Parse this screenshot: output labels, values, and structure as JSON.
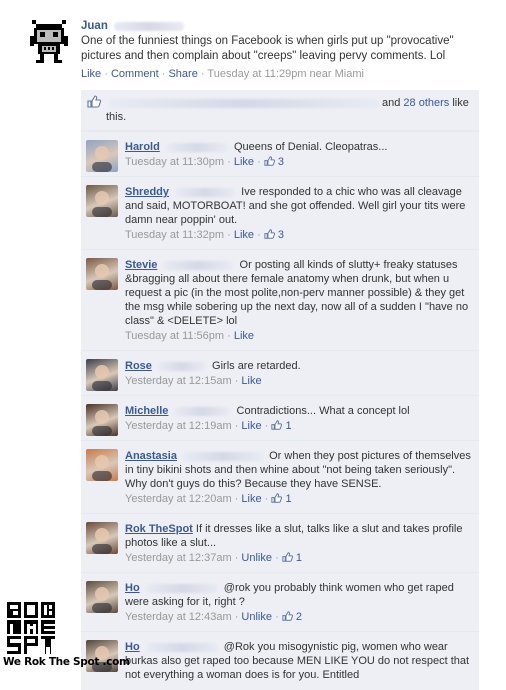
{
  "post": {
    "author": "Juan",
    "text": "One of the funniest things on Facebook is when girls put up \"provocative\" pictures and then complain about \"creeps\" leaving pervy comments. Lol",
    "actions": {
      "like": "Like",
      "comment": "Comment",
      "share": "Share"
    },
    "separator": "·",
    "timestamp": "Tuesday at 11:29pm near Miami"
  },
  "likes": {
    "and": "and",
    "others": "28 others",
    "suffix_before": "like",
    "suffix_after": "this."
  },
  "comments": [
    {
      "name": "Harold",
      "text": "Queens of Denial. Cleopatras...",
      "time": "Tuesday at 11:30pm",
      "action": "Like",
      "likes": "3"
    },
    {
      "name": "Shreddy",
      "text": "Ive responded to a chic who was all cleavage and said, MOTORBOAT! and she got offended. Well girl your tits were damn near poppin' out.",
      "time": "Tuesday at 11:32pm",
      "action": "Like",
      "likes": "3"
    },
    {
      "name": "Stevie",
      "text": "Or posting all kinds of slutty+ freaky statuses &bragging all about there female anatomy when drunk, but when u request a pic (in the most polite,non-perv manner possible) & they get the msg while sobering up the next day, now all of a sudden I \"have no class\" & <DELETE> lol",
      "time": "Tuesday at 11:56pm",
      "action": "Like",
      "likes": ""
    },
    {
      "name": "Rose",
      "text": "Girls are retarded.",
      "time": "Yesterday at 12:15am",
      "action": "Like",
      "likes": ""
    },
    {
      "name": "Michelle",
      "text": "Contradictions... What a concept lol",
      "time": "Yesterday at 12:19am",
      "action": "Like",
      "likes": "1"
    },
    {
      "name": "Anastasia",
      "text": "Or when they post pictures of themselves in tiny bikini shots and then whine about \"not being taken seriously\". Why don't guys do this? Because they have SENSE.",
      "time": "Yesterday at 12:20am",
      "action": "Like",
      "likes": "1"
    },
    {
      "name": "Rok TheSpot",
      "text": "If it dresses like a slut, talks like a slut and takes profile photos like a slut...",
      "time": "Yesterday at 12:37am",
      "action": "Unlike",
      "likes": "1"
    },
    {
      "name": "Ho",
      "text": "@rok you probably think women who get raped were asking for it, right ?",
      "time": "Yesterday at 12:43am",
      "action": "Unlike",
      "likes": "2"
    },
    {
      "name": "Ho",
      "text": "@Rok you misogynistic pig, women who wear burkas also get raped too because MEN LIKE YOU do not respect that not everything a woman does is for you. Entitled",
      "time": "",
      "action": "",
      "likes": ""
    }
  ],
  "watermark": {
    "logo_text": "ROK THE SPOT",
    "caption": "We Rok The Spot .com"
  }
}
